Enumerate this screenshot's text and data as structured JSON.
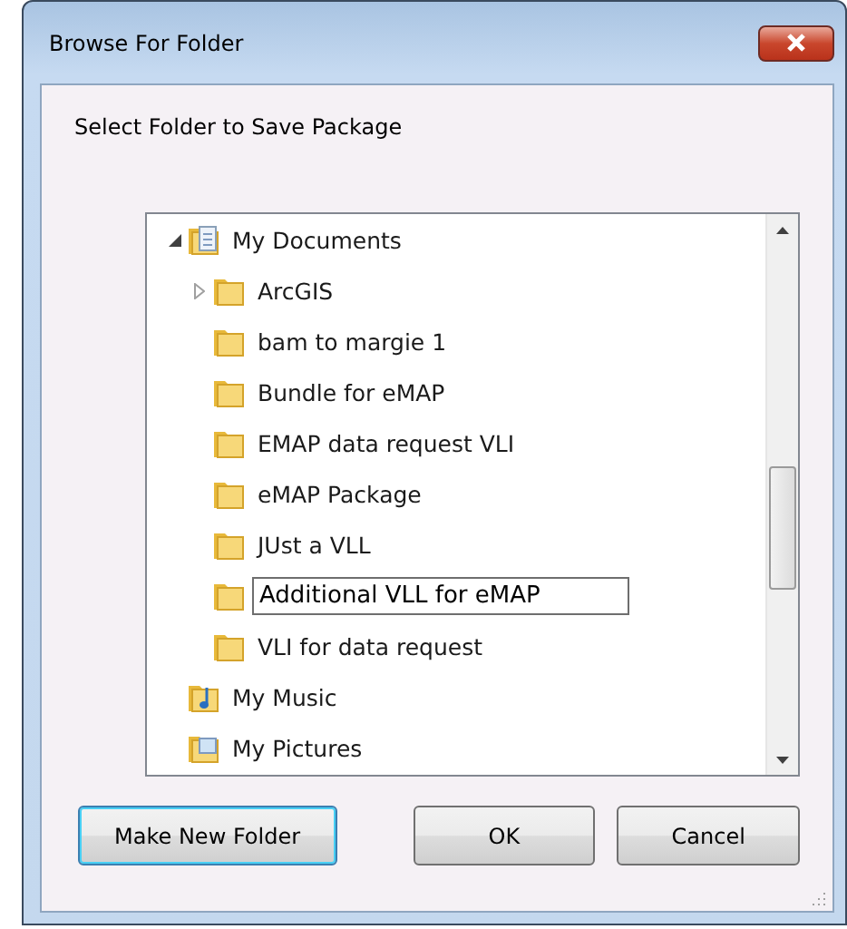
{
  "window": {
    "title": "Browse For Folder"
  },
  "prompt": "Select Folder to Save Package",
  "tree": [
    {
      "label": "My Documents",
      "kind": "documents",
      "expanded": true,
      "editing": false,
      "children": [
        {
          "label": "ArcGIS",
          "kind": "folder",
          "expanded": false,
          "editing": false
        },
        {
          "label": "bam to margie 1",
          "kind": "folder",
          "editing": false
        },
        {
          "label": "Bundle for eMAP",
          "kind": "folder",
          "editing": false
        },
        {
          "label": "EMAP data request VLI",
          "kind": "folder",
          "editing": false
        },
        {
          "label": "eMAP Package",
          "kind": "folder",
          "editing": false
        },
        {
          "label": "JUst a VLL",
          "kind": "folder",
          "editing": false
        },
        {
          "label": "Additional VLL for eMAP",
          "kind": "folder",
          "editing": true
        },
        {
          "label": "VLI for data request",
          "kind": "folder",
          "editing": false
        }
      ]
    },
    {
      "label": "My Music",
      "kind": "music",
      "editing": false
    },
    {
      "label": "My Pictures",
      "kind": "pictures",
      "editing": false
    }
  ],
  "buttons": [
    {
      "label": "Make New Folder",
      "default": true
    },
    {
      "label": "OK",
      "default": false
    },
    {
      "label": "Cancel",
      "default": false
    }
  ]
}
